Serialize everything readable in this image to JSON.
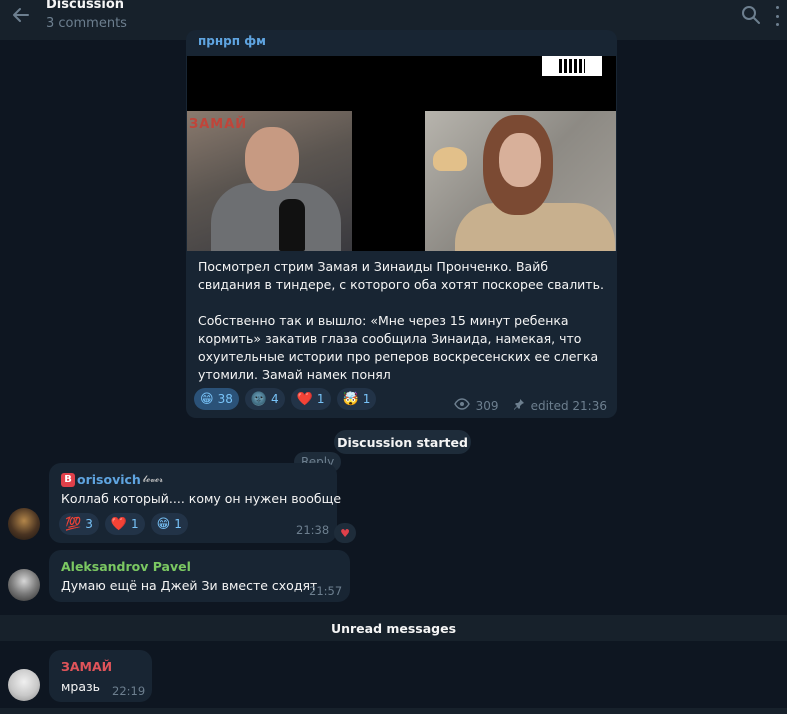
{
  "header": {
    "title": "Discussion",
    "subtitle": "3 comments"
  },
  "post": {
    "channel": "прнрп фм",
    "video": {
      "logo": "ЗАМАЙ"
    },
    "text_p1": "Посмотрел стрим Замая и Зинаиды Пронченко. Вайб свидания в тиндере, с которого оба хотят поскорее свалить.",
    "text_p2": "Собственно так и вышло: «Мне через 15 минут ребенка кормить» закатив глаза сообщила Зинаида, намекая, что охуительные истории про реперов воскресенских ее слегка утомили. Замай намек понял",
    "reactions": [
      {
        "emoji": "😁",
        "count": "38",
        "active": true
      },
      {
        "emoji": "🌚",
        "count": "4",
        "active": false
      },
      {
        "emoji": "❤️",
        "count": "1",
        "active": false
      },
      {
        "emoji": "🤯",
        "count": "1",
        "active": false
      }
    ],
    "views": "309",
    "edited": "edited 21:36"
  },
  "discussion_started": "Discussion started",
  "reply_label": "Reply",
  "comments": [
    {
      "author": "orisovich",
      "author_badge": "B",
      "author_suffix": "𝓵𝓮𝓿𝓮𝓻",
      "text": "Коллаб который.... кому он нужен вообще",
      "time": "21:38",
      "reactions": [
        {
          "emoji": "💯",
          "count": "3",
          "active": false
        },
        {
          "emoji": "❤️",
          "count": "1",
          "active": false
        },
        {
          "emoji": "😁",
          "count": "1",
          "active": false
        }
      ],
      "mini_reaction": "♥"
    },
    {
      "author": "Aleksandrov Pavel",
      "text": "Думаю ещё на Джей Зи вместе сходят",
      "time": "21:57"
    }
  ],
  "unread_label": "Unread messages",
  "last_message": {
    "author": "ЗАМАЙ",
    "text": "мразь",
    "time": "22:19"
  },
  "colors": {
    "background": "#0e1621",
    "bubble": "#182533",
    "accent": "#5fa4e0",
    "author_borisovich": "#5fa4e0",
    "author_pavel": "#7bc862",
    "author_zamay": "#e0545a"
  }
}
